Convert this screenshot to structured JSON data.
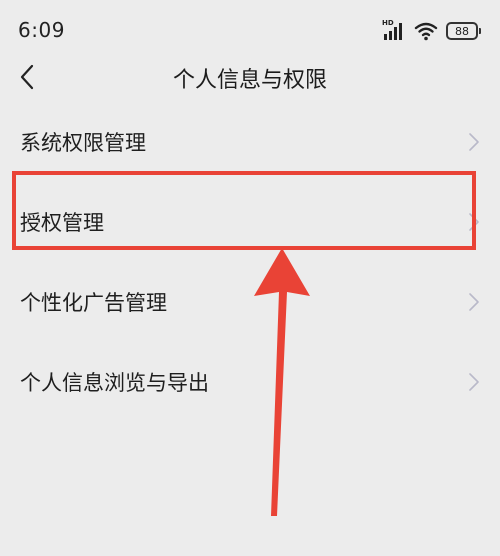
{
  "status_bar": {
    "time": "6:09",
    "hd_label": "HD",
    "battery_level": "88"
  },
  "header": {
    "title": "个人信息与权限"
  },
  "menu": {
    "items": [
      {
        "label": "系统权限管理"
      },
      {
        "label": "授权管理"
      },
      {
        "label": "个性化广告管理"
      },
      {
        "label": "个人信息浏览与导出"
      }
    ]
  },
  "colors": {
    "background": "#ececec",
    "annotation_red": "#e94336",
    "chevron": "#b9b9c9",
    "text": "#1f1f1f"
  },
  "icons": {
    "back": "back-arrow-icon",
    "chevron": "chevron-right-icon",
    "signal": "cellular-signal-icon",
    "wifi": "wifi-icon",
    "battery": "battery-icon"
  }
}
